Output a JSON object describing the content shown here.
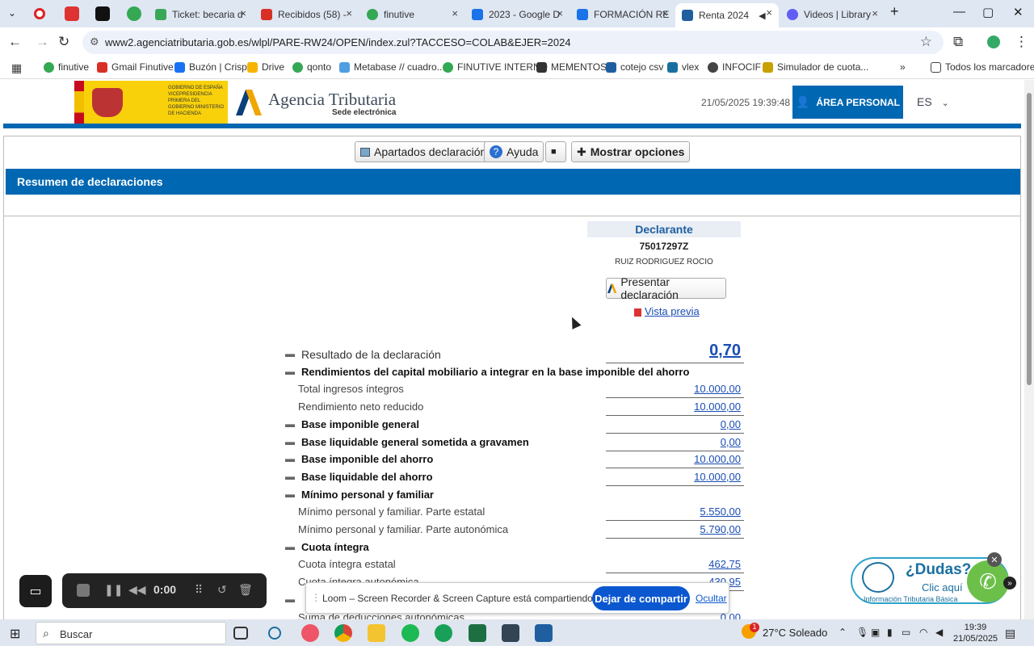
{
  "browser": {
    "tabs": [
      {
        "label": "Ticket: becaria d",
        "color": "#3aa757"
      },
      {
        "label": "Recibidos (58) -",
        "color": "#d93025"
      },
      {
        "label": "finutive",
        "color": "#34a853"
      },
      {
        "label": "2023 - Google D",
        "color": "#1a73e8"
      },
      {
        "label": "FORMACIÓN RE",
        "color": "#1a73e8"
      },
      {
        "label": "Renta 2024",
        "color": "#1f5fa0"
      },
      {
        "label": "Videos | Library",
        "color": "#625df5"
      }
    ],
    "close_glyph": "×",
    "new_tab_glyph": "+",
    "url": "www2.agenciatributaria.gob.es/wlpl/PARE-RW24/OPEN/index.zul?TACCESO=COLAB&EJER=2024",
    "bookmarks": [
      "finutive",
      "Gmail Finutive",
      "Buzón | Crisp",
      "Drive",
      "qonto",
      "Metabase // cuadro...",
      "FINUTIVE INTERNO",
      "MEMENTOS",
      "cotejo csv",
      "vlex",
      "INFOCIF",
      "Simulador de cuota..."
    ],
    "all_bookmarks": "Todos los marcadores"
  },
  "header": {
    "gov_text": "GOBIERNO DE ESPAÑA VICEPRESIDENCIA PRIMERA DEL GOBIERNO MINISTERIO DE HACIENDA",
    "agency_name": "Agencia Tributaria",
    "agency_sub": "Sede electrónica",
    "datetime": "21/05/2025 19:39:48",
    "area_personal": "ÁREA PERSONAL",
    "lang": "ES"
  },
  "toolbar": {
    "apartados": "Apartados declaración",
    "ayuda": "Ayuda",
    "mostrar": "Mostrar opciones"
  },
  "section_title": "Resumen de declaraciones",
  "declarante": {
    "heading": "Declarante",
    "nif": "75017297Z",
    "nombre": "RUIZ RODRIGUEZ ROCIO",
    "presentar": "Presentar declaración",
    "vista_previa": "Vista previa"
  },
  "summary_rows": [
    {
      "label": "Resultado de la declaración",
      "value": "0,70",
      "kind": "result"
    },
    {
      "label": "Rendimientos del capital mobiliario a integrar en la base imponible del ahorro",
      "value": "",
      "kind": "bold"
    },
    {
      "label": "Total ingresos íntegros",
      "value": "10.000,00",
      "kind": "sub"
    },
    {
      "label": "Rendimiento neto reducido",
      "value": "10.000,00",
      "kind": "sub"
    },
    {
      "label": "Base imponible general",
      "value": "0,00",
      "kind": "bold"
    },
    {
      "label": "Base liquidable general sometida a gravamen",
      "value": "0,00",
      "kind": "bold"
    },
    {
      "label": "Base imponible del ahorro",
      "value": "10.000,00",
      "kind": "bold"
    },
    {
      "label": "Base liquidable del ahorro",
      "value": "10.000,00",
      "kind": "bold"
    },
    {
      "label": "Mínimo personal y familiar",
      "value": "",
      "kind": "bold"
    },
    {
      "label": "Mínimo personal y familiar. Parte estatal",
      "value": "5.550,00",
      "kind": "sub"
    },
    {
      "label": "Mínimo personal y familiar. Parte autonómica",
      "value": "5.790,00",
      "kind": "sub"
    },
    {
      "label": "Cuota íntegra",
      "value": "",
      "kind": "bold"
    },
    {
      "label": "Cuota íntegra estatal",
      "value": "462,75",
      "kind": "sub"
    },
    {
      "label": "Cuota íntegra autonómica",
      "value": "430,95",
      "kind": "sub"
    },
    {
      "label": "",
      "value": "",
      "kind": "bold"
    },
    {
      "label": "Suma de deducciones autonómicas",
      "value": "0,00",
      "kind": "sub"
    }
  ],
  "toggle_glyph": "▬",
  "recorder": {
    "time": "0:00"
  },
  "share_bar": {
    "message": "Loom – Screen Recorder & Screen Capture está compartiendo tu pantalla.",
    "stop": "Dejar de compartir",
    "hide": "Ocultar"
  },
  "dudas": {
    "question": "¿Dudas?",
    "cta": "Clic aquí",
    "info": "Información Tributaria Básica"
  },
  "taskbar": {
    "search_placeholder": "Buscar",
    "weather": "27°C  Soleado",
    "time": "19:39",
    "date": "21/05/2025",
    "notif_count": "1"
  }
}
